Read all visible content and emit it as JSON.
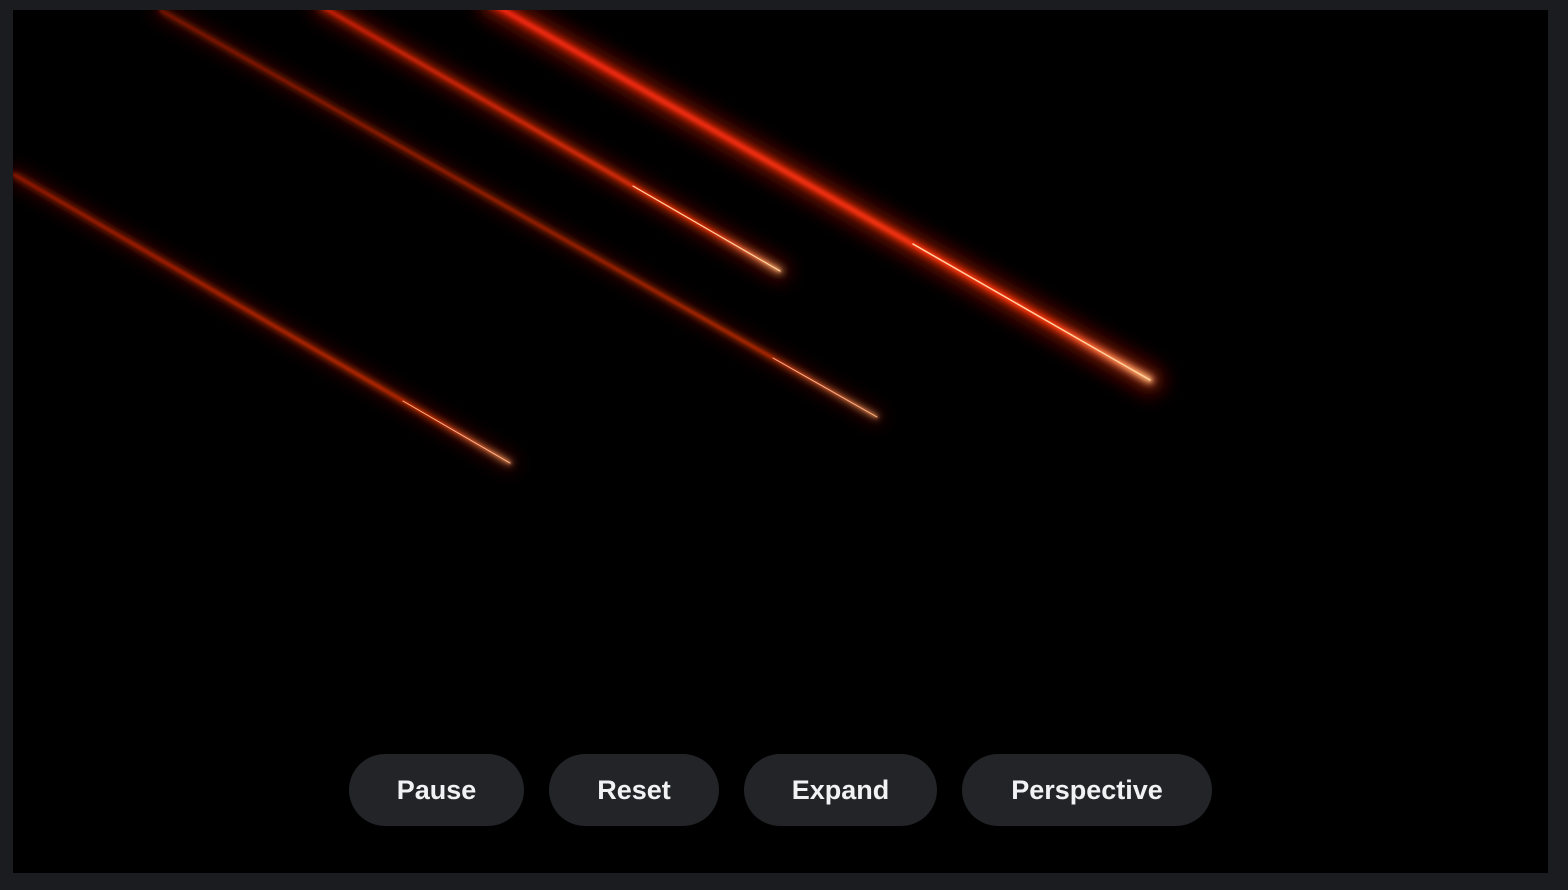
{
  "scene": {
    "background": "#000000",
    "streak_color": "#ff3a0a",
    "streak_core_color": "#ffd2a0"
  },
  "controls": {
    "pause_label": "Pause",
    "reset_label": "Reset",
    "expand_label": "Expand",
    "perspective_label": "Perspective"
  }
}
